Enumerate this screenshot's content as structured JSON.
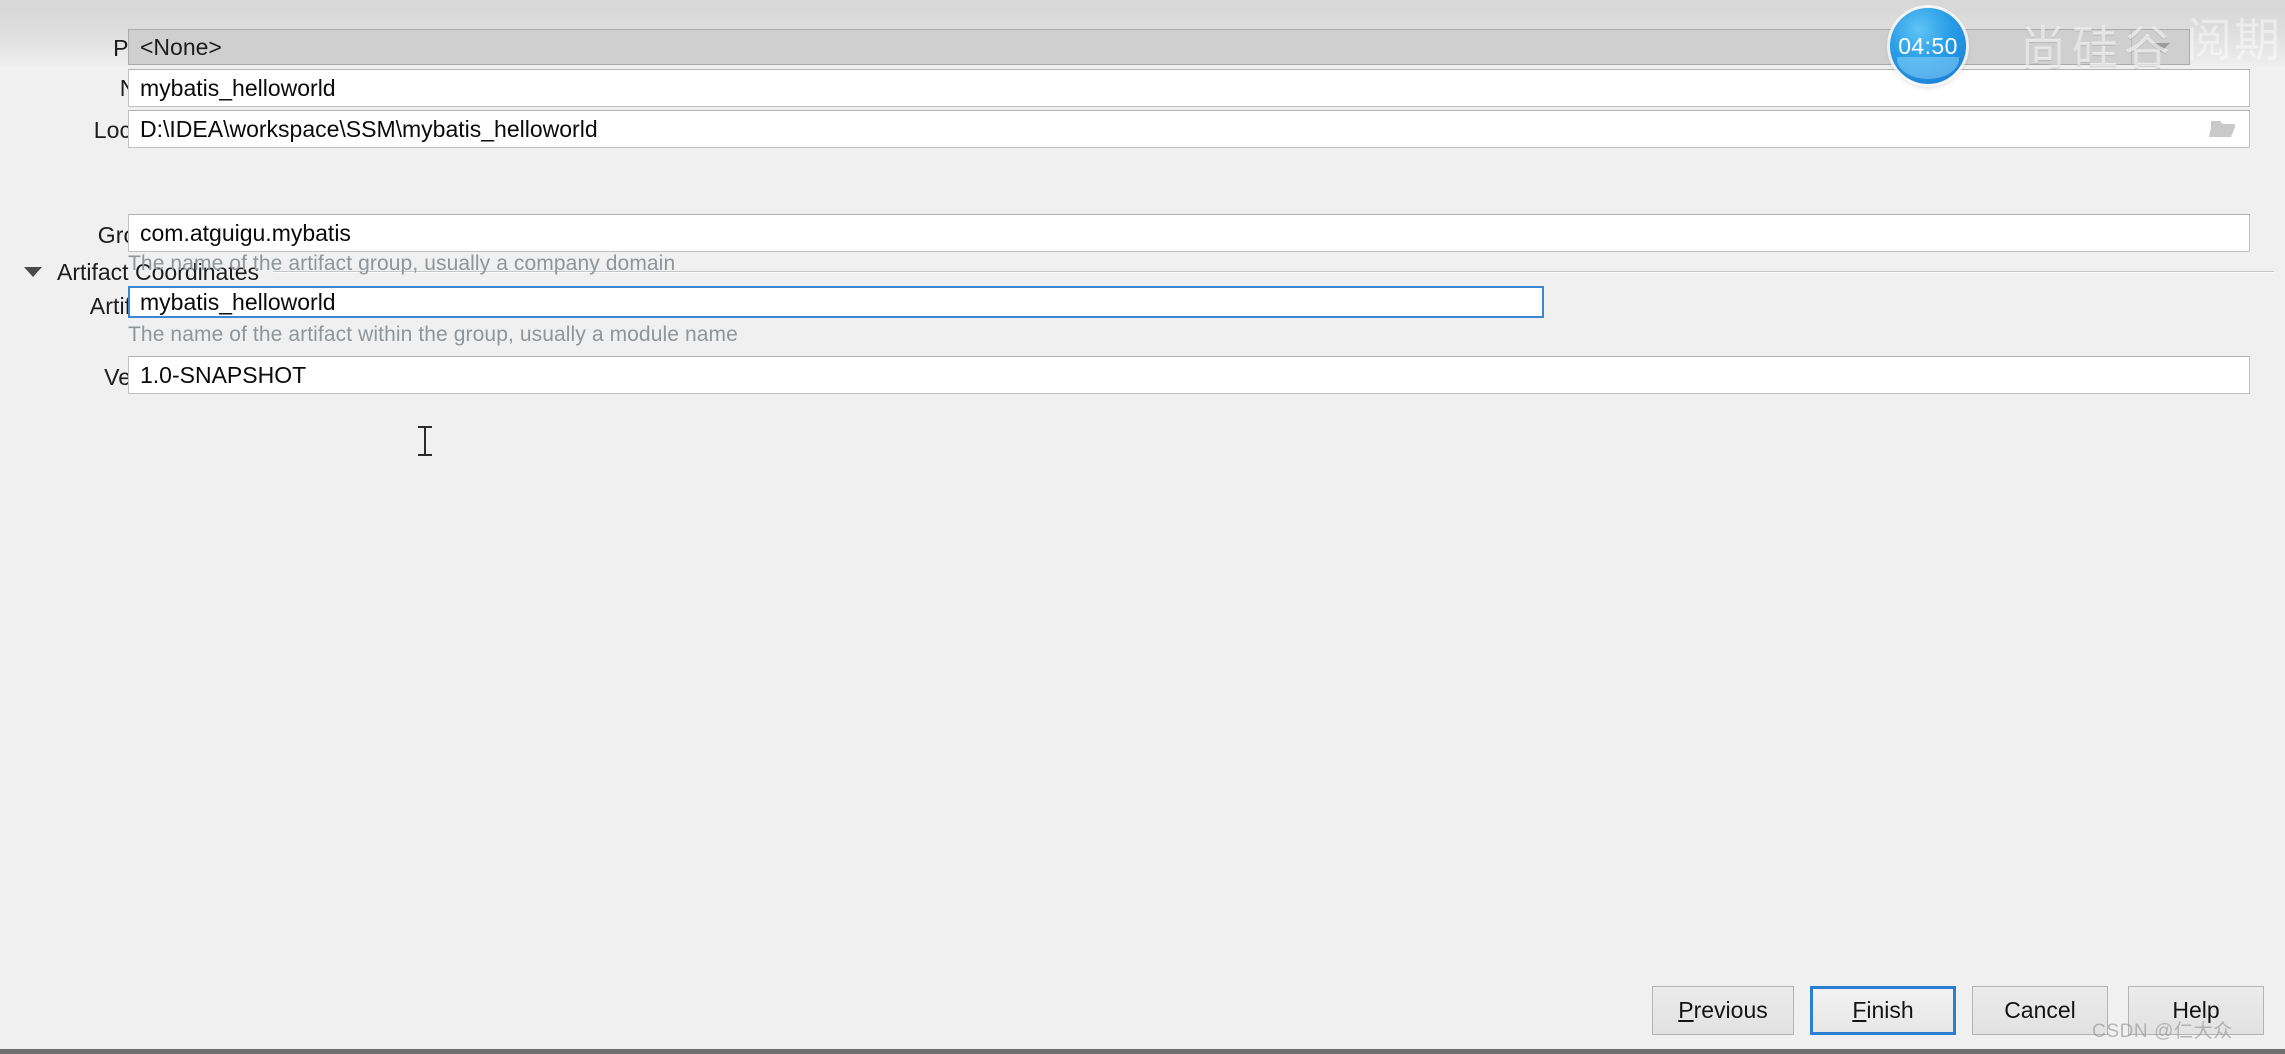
{
  "dialog": {
    "fields": [
      {
        "label": "Parent:",
        "value": "<None>",
        "type": "combobox",
        "state": "disabled"
      },
      {
        "label": "Name:",
        "value": "mybatis_helloworld",
        "type": "text",
        "state": "normal"
      },
      {
        "label": "Location:",
        "value": "D:\\IDEA\\workspace\\SSM\\mybatis_helloworld",
        "type": "text-with-browse",
        "state": "normal",
        "browse_icon": "folder-icon"
      }
    ],
    "section": {
      "title": "Artifact Coordinates",
      "expander_icon": "chevron-down-icon",
      "expanded": true,
      "fields": [
        {
          "label": "GroupId:",
          "value": "com.atguigu.mybatis",
          "hint": "The name of the artifact group, usually a company domain",
          "state": "normal"
        },
        {
          "label": "ArtifactId:",
          "value": "mybatis_helloworld",
          "hint": "The name of the artifact within the group, usually a module name",
          "state": "focused"
        },
        {
          "label": "Version:",
          "value": "1.0-SNAPSHOT",
          "hint": "",
          "state": "normal"
        }
      ]
    },
    "buttons": [
      {
        "mnemonic": "P",
        "rest": "revious",
        "label": "Previous",
        "primary": false
      },
      {
        "mnemonic": "F",
        "rest": "inish",
        "label": "Finish",
        "primary": true
      },
      {
        "mnemonic": "",
        "rest": "Cancel",
        "label": "Cancel",
        "primary": false
      },
      {
        "mnemonic": "",
        "rest": "Help",
        "label": "Help",
        "primary": false
      }
    ]
  },
  "overlays": {
    "timer": {
      "value": "04:50"
    },
    "watermark_cn": "尚硅谷",
    "watermark_cn_right": "阅期",
    "watermark_csdn": "CSDN @仁大众"
  },
  "colors": {
    "focus_blue": "#3b87d4",
    "primary_border": "#2b7fd3",
    "panel_bg": "#f0f0f0",
    "field_bg": "#ffffff",
    "disabled_bg": "#cfcfcf",
    "hint_text": "#8f9599"
  }
}
